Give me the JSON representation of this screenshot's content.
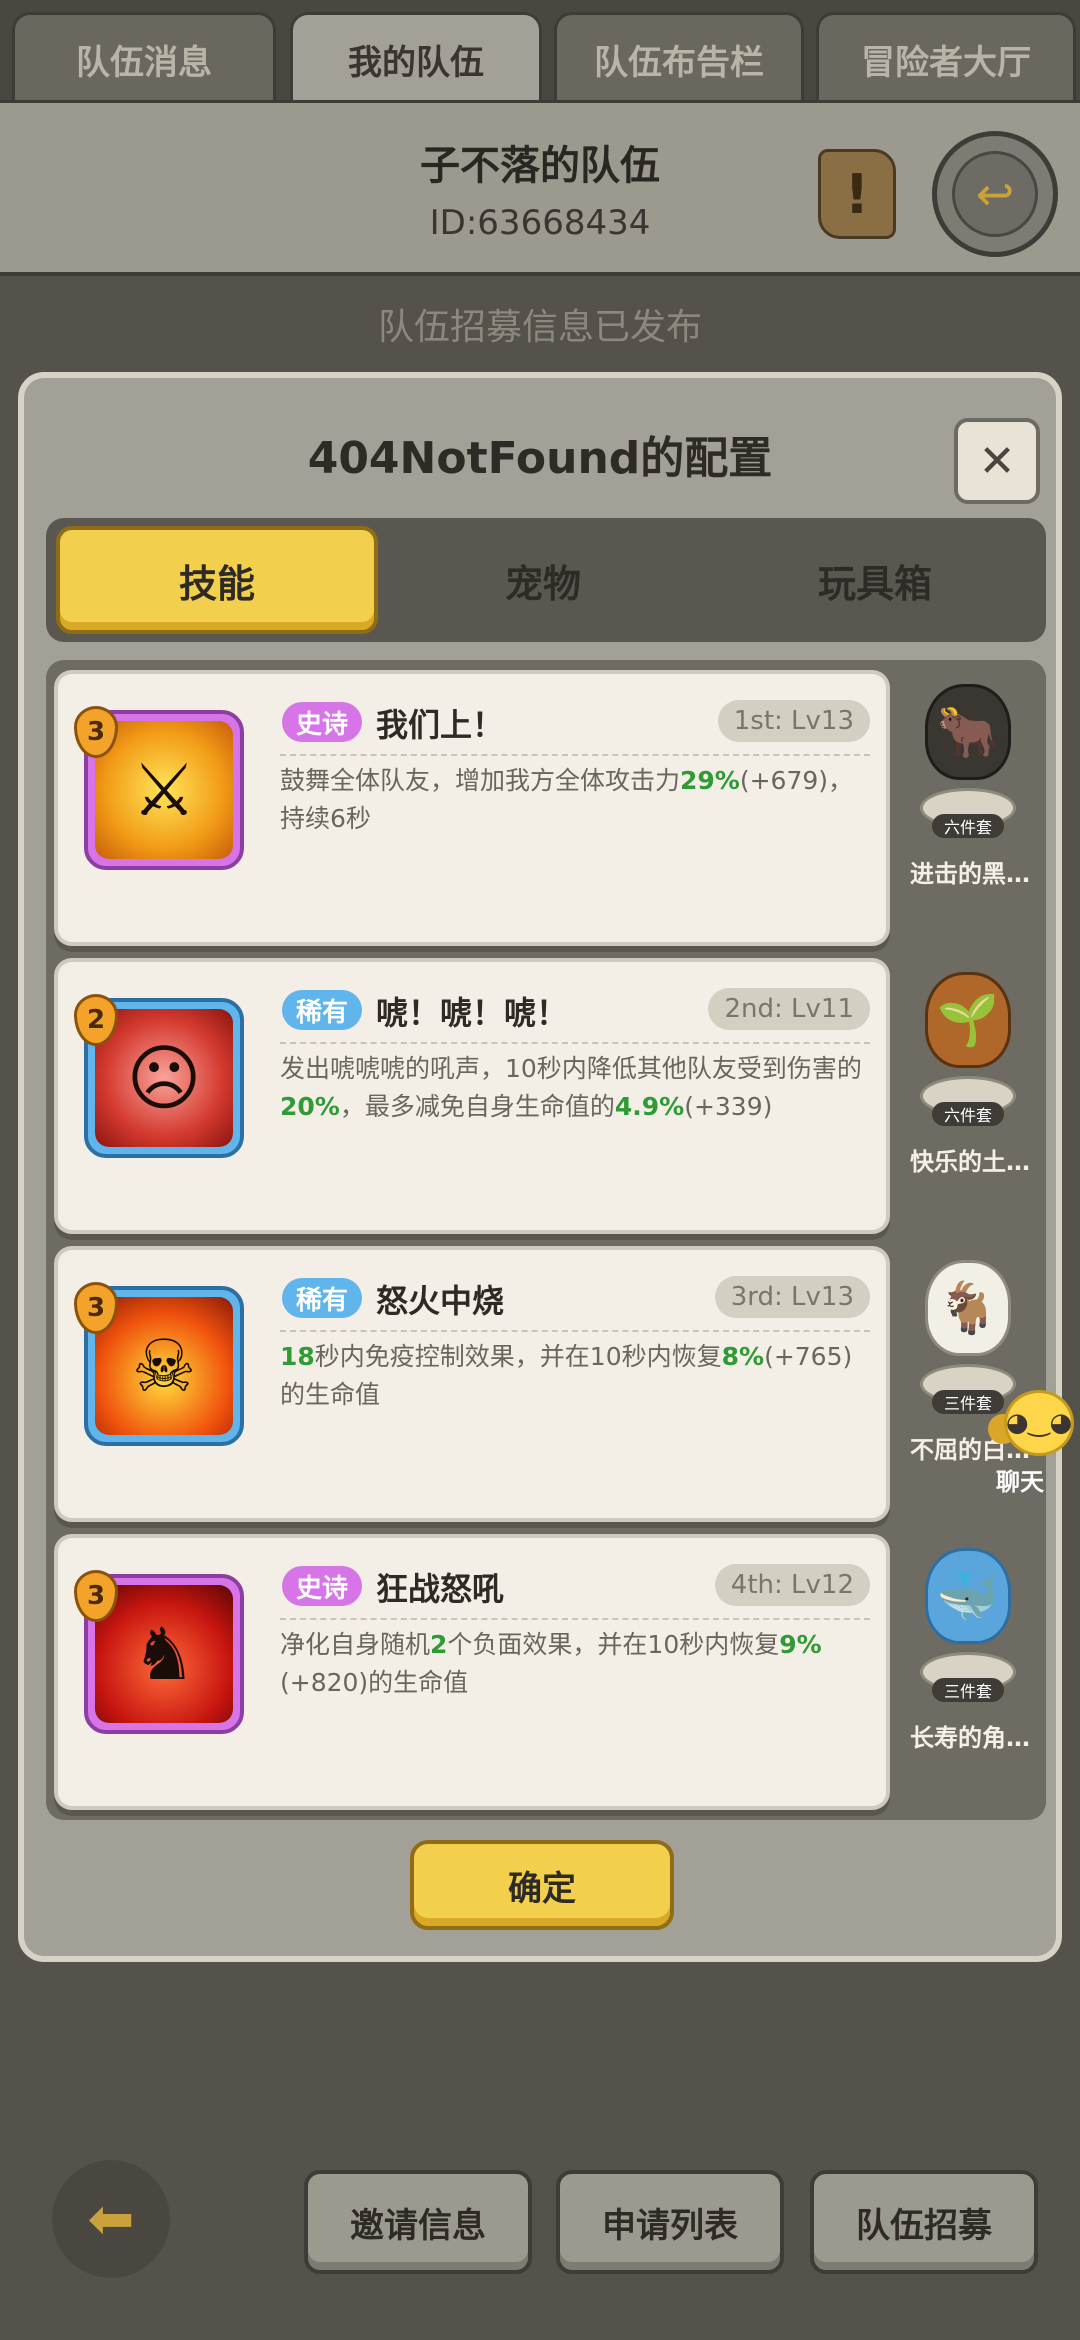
{
  "top_tabs": [
    "队伍消息",
    "我的队伍",
    "队伍布告栏",
    "冒险者大厅"
  ],
  "header": {
    "team_name": "子不落的队伍",
    "team_id": "ID:63668434"
  },
  "recruit_banner": "队伍招募信息已发布",
  "modal": {
    "title": "404NotFound的配置",
    "tabs": [
      "技能",
      "宠物",
      "玩具箱"
    ],
    "active_tab": "技能",
    "confirm_label": "确定"
  },
  "skills": [
    {
      "rarity": "史诗",
      "rarity_type": "epic",
      "name": "我们上！",
      "slot": "1st: Lv13",
      "level": "3",
      "desc_parts": [
        "鼓舞全体队友，增加我方全体攻击力",
        "29%",
        "(+679)",
        "，持续6秒"
      ],
      "pet": {
        "name": "进击的黑…",
        "set": "六件套",
        "icon": "black-cow-pet-icon"
      }
    },
    {
      "rarity": "稀有",
      "rarity_type": "rare",
      "name": "唬！唬！唬！",
      "slot": "2nd: Lv11",
      "level": "2",
      "desc_parts": [
        "发出唬唬唬的吼声，10秒内降低其他队友受到伤害的",
        "20%",
        "，最多减免自身生命值的",
        "4.9%",
        "(+339)"
      ],
      "pet": {
        "name": "快乐的土…",
        "set": "六件套",
        "icon": "groundhog-pet-icon"
      }
    },
    {
      "rarity": "稀有",
      "rarity_type": "rare",
      "name": "怒火中烧",
      "slot": "3rd: Lv13",
      "level": "3",
      "desc_parts": [
        "18",
        "秒内免疫控制效果，并在10秒内恢复",
        "8%",
        "(+765)",
        "的生命值"
      ],
      "pet": {
        "name": "不屈的白…",
        "set": "三件套",
        "icon": "goat-pet-icon"
      }
    },
    {
      "rarity": "史诗",
      "rarity_type": "epic",
      "name": "狂战怒吼",
      "slot": "4th: Lv12",
      "level": "3",
      "desc_parts": [
        "净化自身随机",
        "2",
        "个负面效果，并在10秒内恢复",
        "9%",
        "(+820)",
        "的生命值"
      ],
      "pet": {
        "name": "长寿的角…",
        "set": "三件套",
        "icon": "narwhal-pet-icon"
      }
    }
  ],
  "chat": {
    "label": "聊天"
  },
  "bottom_buttons": [
    "邀请信息",
    "申请列表",
    "队伍招募"
  ],
  "colors": {
    "accent_yellow": "#f2cf4c",
    "epic": "#d674e8",
    "rare": "#5fb5ec",
    "highlight_green": "#2f9a36"
  }
}
